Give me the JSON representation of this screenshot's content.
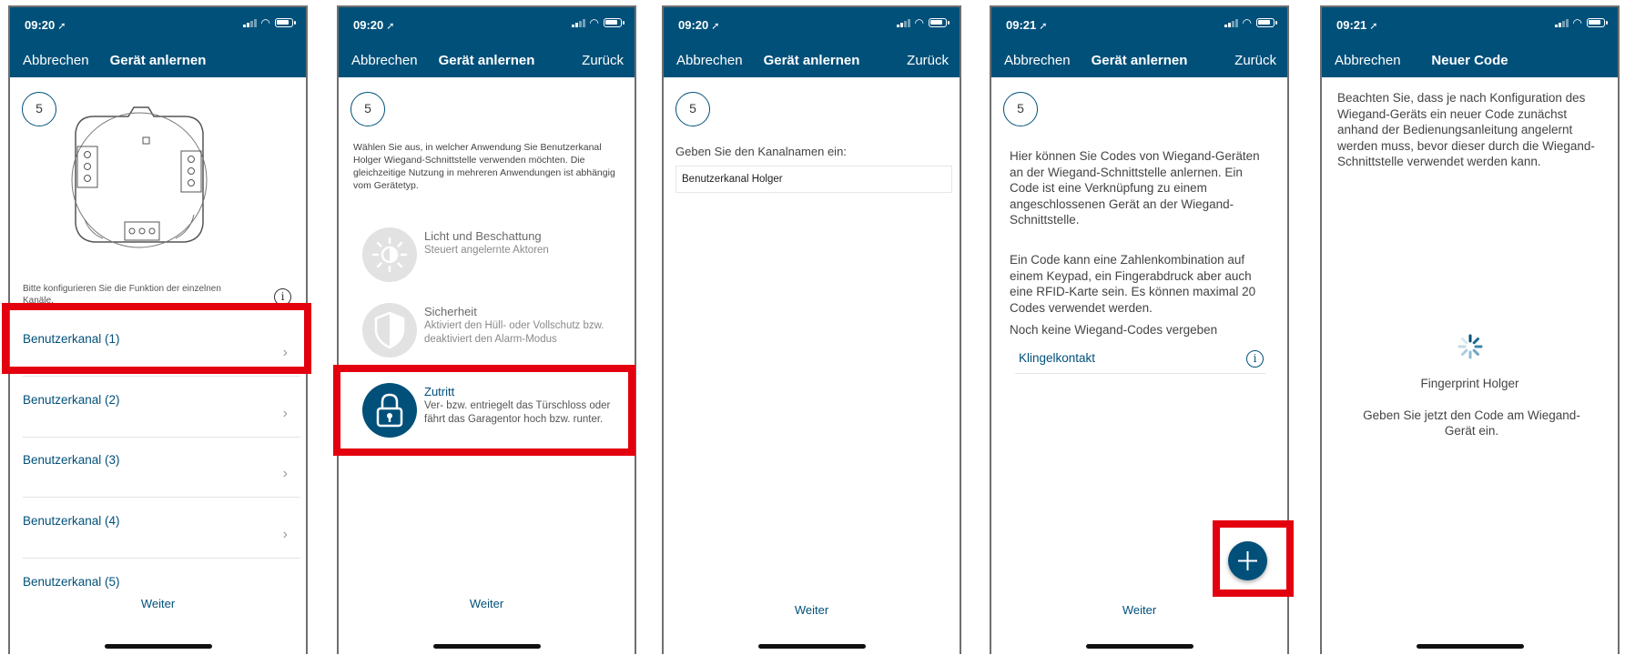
{
  "status_bar": {
    "time_a": "09:20",
    "time_b": "09:21"
  },
  "common": {
    "cancel": "Abbrechen",
    "back": "Zurück",
    "next": "Weiter",
    "step": "5"
  },
  "screen1": {
    "title": "Gerät anlernen",
    "hint": "Bitte konfigurieren Sie die Funktion der einzelnen Kanäle.",
    "channels": [
      {
        "label": "Benutzerkanal (1)"
      },
      {
        "label": "Benutzerkanal (2)"
      },
      {
        "label": "Benutzerkanal (3)"
      },
      {
        "label": "Benutzerkanal (4)"
      },
      {
        "label": "Benutzerkanal (5)"
      }
    ]
  },
  "screen2": {
    "title": "Gerät anlernen",
    "intro": "Wählen Sie aus, in welcher Anwendung Sie Benutzerkanal Holger  Wiegand-Schnittstelle verwenden möchten. Die gleichzeitige Nutzung in mehreren Anwendungen ist abhängig vom Gerätetyp.",
    "apps": [
      {
        "name": "Licht und Beschattung",
        "desc": "Steuert angelernte Aktoren",
        "icon": "light-icon"
      },
      {
        "name": "Sicherheit",
        "desc": "Aktiviert den Hüll- oder Vollschutz bzw. deaktiviert den Alarm-Modus",
        "icon": "shield-icon"
      },
      {
        "name": "Zutritt",
        "desc": "Ver- bzw. entriegelt das Türschloss oder fährt das Garagentor hoch bzw. runter.",
        "icon": "lock-icon"
      }
    ]
  },
  "screen3": {
    "title": "Gerät anlernen",
    "label": "Geben Sie den Kanalnamen ein:",
    "channel_name": "Benutzerkanal Holger"
  },
  "screen4": {
    "title": "Gerät anlernen",
    "para1": "Hier können Sie Codes von Wiegand-Geräten an der Wiegand-Schnittstelle anlernen. Ein Code ist eine Verknüpfung zu einem angeschlossenen Gerät an der Wiegand-Schnittstelle.",
    "para2": "Ein Code kann eine Zahlenkombination auf einem Keypad, ein Fingerabdruck aber auch eine RFID-Karte sein. Es können maximal 20 Codes verwendet werden.",
    "no_codes": "Noch keine Wiegand-Codes vergeben",
    "item": "Klingelkontakt"
  },
  "screen5": {
    "title": "Neuer Code",
    "text": "Beachten Sie, dass je nach Konfiguration des Wiegand-Geräts ein neuer Code zunächst anhand der Bedienungsanleitung angelernt werden muss, bevor dieser durch die Wiegand-Schnittstelle verwendet werden kann.",
    "device_name": "Fingerprint Holger",
    "prompt": "Geben Sie jetzt den Code am Wiegand-Gerät ein."
  },
  "colors": {
    "brand": "#00507a",
    "highlight": "#e3000f"
  }
}
